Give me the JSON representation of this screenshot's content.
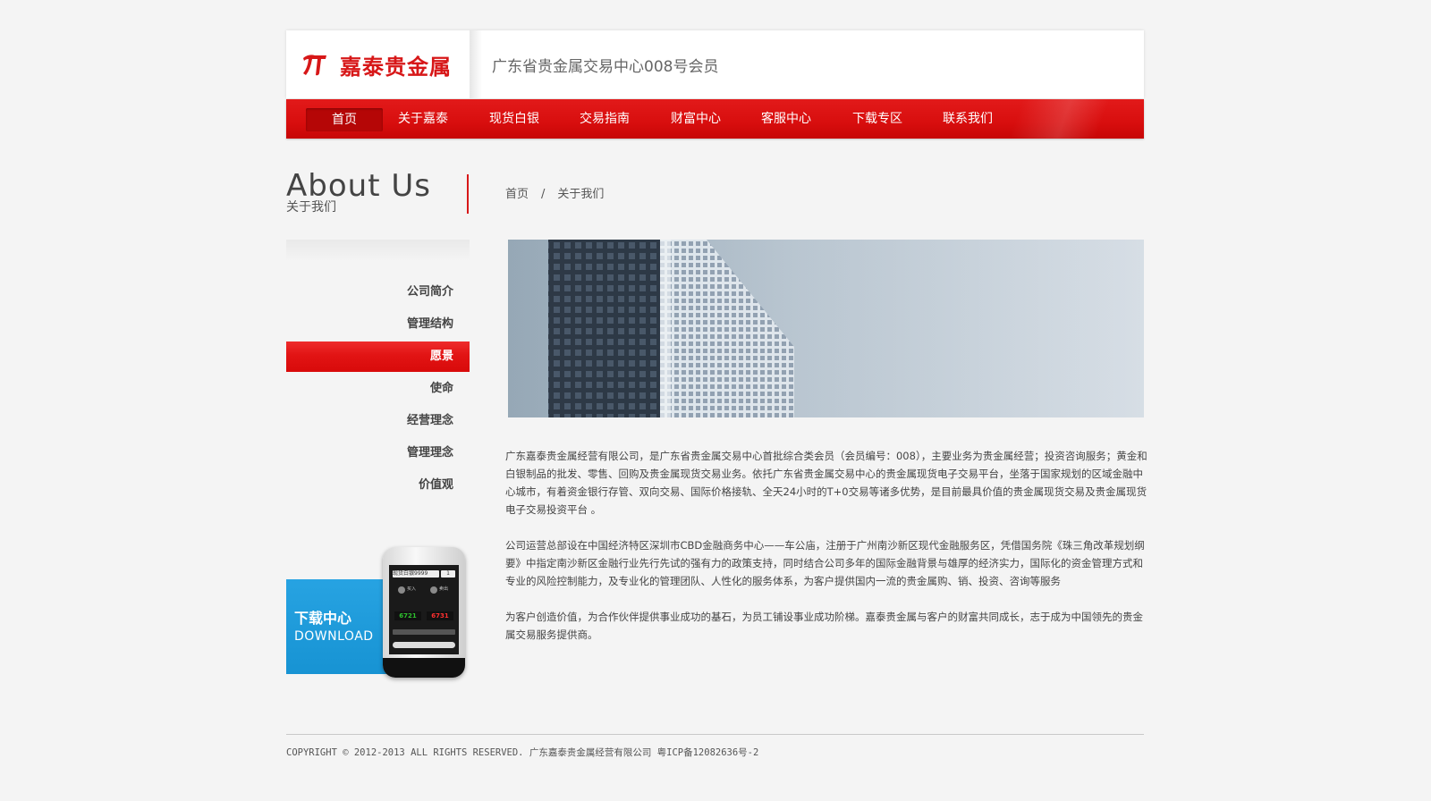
{
  "header": {
    "logo_text": "嘉泰贵金属",
    "slogan": "广东省贵金属交易中心008号会员"
  },
  "nav": {
    "items": [
      {
        "label": "首页"
      },
      {
        "label": "关于嘉泰"
      },
      {
        "label": "现货白银"
      },
      {
        "label": "交易指南"
      },
      {
        "label": "财富中心"
      },
      {
        "label": "客服中心"
      },
      {
        "label": "下载专区"
      },
      {
        "label": "联系我们"
      }
    ],
    "active_index": 0
  },
  "section": {
    "title": "About Us",
    "subtitle": "关于我们"
  },
  "breadcrumb": {
    "home": "首页",
    "separator": "/",
    "current": "关于我们"
  },
  "side_menu": {
    "items": [
      {
        "label": "公司简介"
      },
      {
        "label": "管理结构"
      },
      {
        "label": "愿景"
      },
      {
        "label": "使命"
      },
      {
        "label": "经营理念"
      },
      {
        "label": "管理理念"
      },
      {
        "label": "价值观"
      }
    ],
    "active_index": 2
  },
  "download": {
    "title": "下载中心",
    "subtitle": "DOWNLOAD",
    "phone_field": "现货白银9999",
    "phone_qty": "1",
    "phone_buy": "买入",
    "phone_sell": "卖出",
    "phone_price_buy": "6721",
    "phone_price_sell": "6731"
  },
  "content": {
    "paragraphs": [
      "广东嘉泰贵金属经营有限公司，是广东省贵金属交易中心首批综合类会员（会员编号：008），主要业务为贵金属经营；投资咨询服务；黄金和白银制品的批发、零售、回购及贵金属现货交易业务。依托广东省贵金属交易中心的贵金属现货电子交易平台，坐落于国家规划的区域金融中心城市，有着资金银行存管、双向交易、国际价格接轨、全天24小时的T+0交易等诸多优势，是目前最具价值的贵金属现货交易及贵金属现货电子交易投资平台 。",
      "公司运营总部设在中国经济特区深圳市CBD金融商务中心——车公庙，注册于广州南沙新区现代金融服务区，凭借国务院《珠三角改革规划纲要》中指定南沙新区金融行业先行先试的强有力的政策支持，同时结合公司多年的国际金融背景与雄厚的经济实力，国际化的资金管理方式和专业的风险控制能力，及专业化的管理团队、人性化的服务体系，为客户提供国内一流的贵金属购、销、投资、咨询等服务",
      "为客户创造价值，为合作伙伴提供事业成功的基石，为员工铺设事业成功阶梯。嘉泰贵金属与客户的财富共同成长，志于成为中国领先的贵金属交易服务提供商。"
    ]
  },
  "footer": {
    "text": "COPYRIGHT © 2012-2013 ALL RIGHTS RESERVED. 广东嘉泰贵金属经营有限公司 粤ICP备12082636号-2"
  },
  "colors": {
    "brand_red": "#d71718",
    "download_blue": "#1793d3"
  }
}
